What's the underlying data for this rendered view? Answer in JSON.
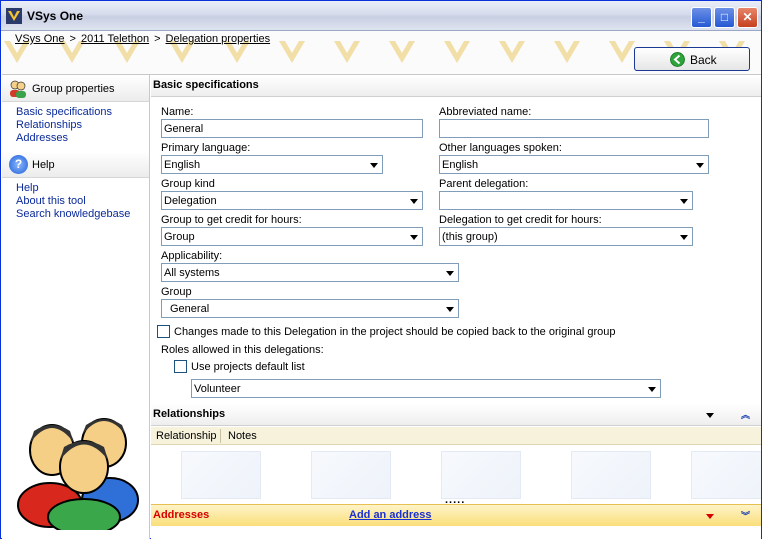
{
  "window": {
    "title": "VSys One",
    "min_glyph": "_",
    "max_glyph": "□",
    "close_glyph": "✕"
  },
  "breadcrumb": {
    "items": [
      "VSys One",
      "2011 Telethon",
      "Delegation properties"
    ],
    "separator": ">"
  },
  "back_button": {
    "label": "Back"
  },
  "left_panel": {
    "group_properties": {
      "title": "Group properties",
      "links": [
        "Basic specifications",
        "Relationships",
        "Addresses"
      ]
    },
    "help": {
      "title": "Help",
      "icon_glyph": "?",
      "links": [
        "Help",
        "About this tool",
        "Search knowledgebase"
      ]
    }
  },
  "basic": {
    "title": "Basic specifications",
    "name_label": "Name:",
    "name_value": "General",
    "abbrev_label": "Abbreviated name:",
    "abbrev_value": "",
    "primary_lang_label": "Primary language:",
    "primary_lang_value": "English",
    "other_lang_label": "Other languages spoken:",
    "other_lang_value": "English",
    "group_kind_label": "Group kind",
    "group_kind_value": "Delegation",
    "parent_label": "Parent delegation:",
    "parent_value": "",
    "credit_group_label": "Group to get credit for hours:",
    "credit_group_value": "Group",
    "credit_deleg_label": "Delegation to get credit for hours:",
    "credit_deleg_value": "(this group)",
    "applicability_label": "Applicability:",
    "applicability_value": "All systems",
    "group_label": "Group",
    "group_value": "General",
    "copy_back_label": "Changes made to this Delegation in the project should be copied back to the original group",
    "roles_label": "Roles allowed in this delegations:",
    "use_default_label": "Use projects default list",
    "roles_value": "Volunteer"
  },
  "relationships": {
    "title": "Relationships",
    "columns": [
      "Relationship",
      "Notes"
    ],
    "dots": "....."
  },
  "addresses": {
    "title": "Addresses",
    "add_link": "Add an address"
  },
  "colors": {
    "accent": "#0831d9",
    "addresses_label": "#d80000",
    "link": "#1a2fd4"
  }
}
